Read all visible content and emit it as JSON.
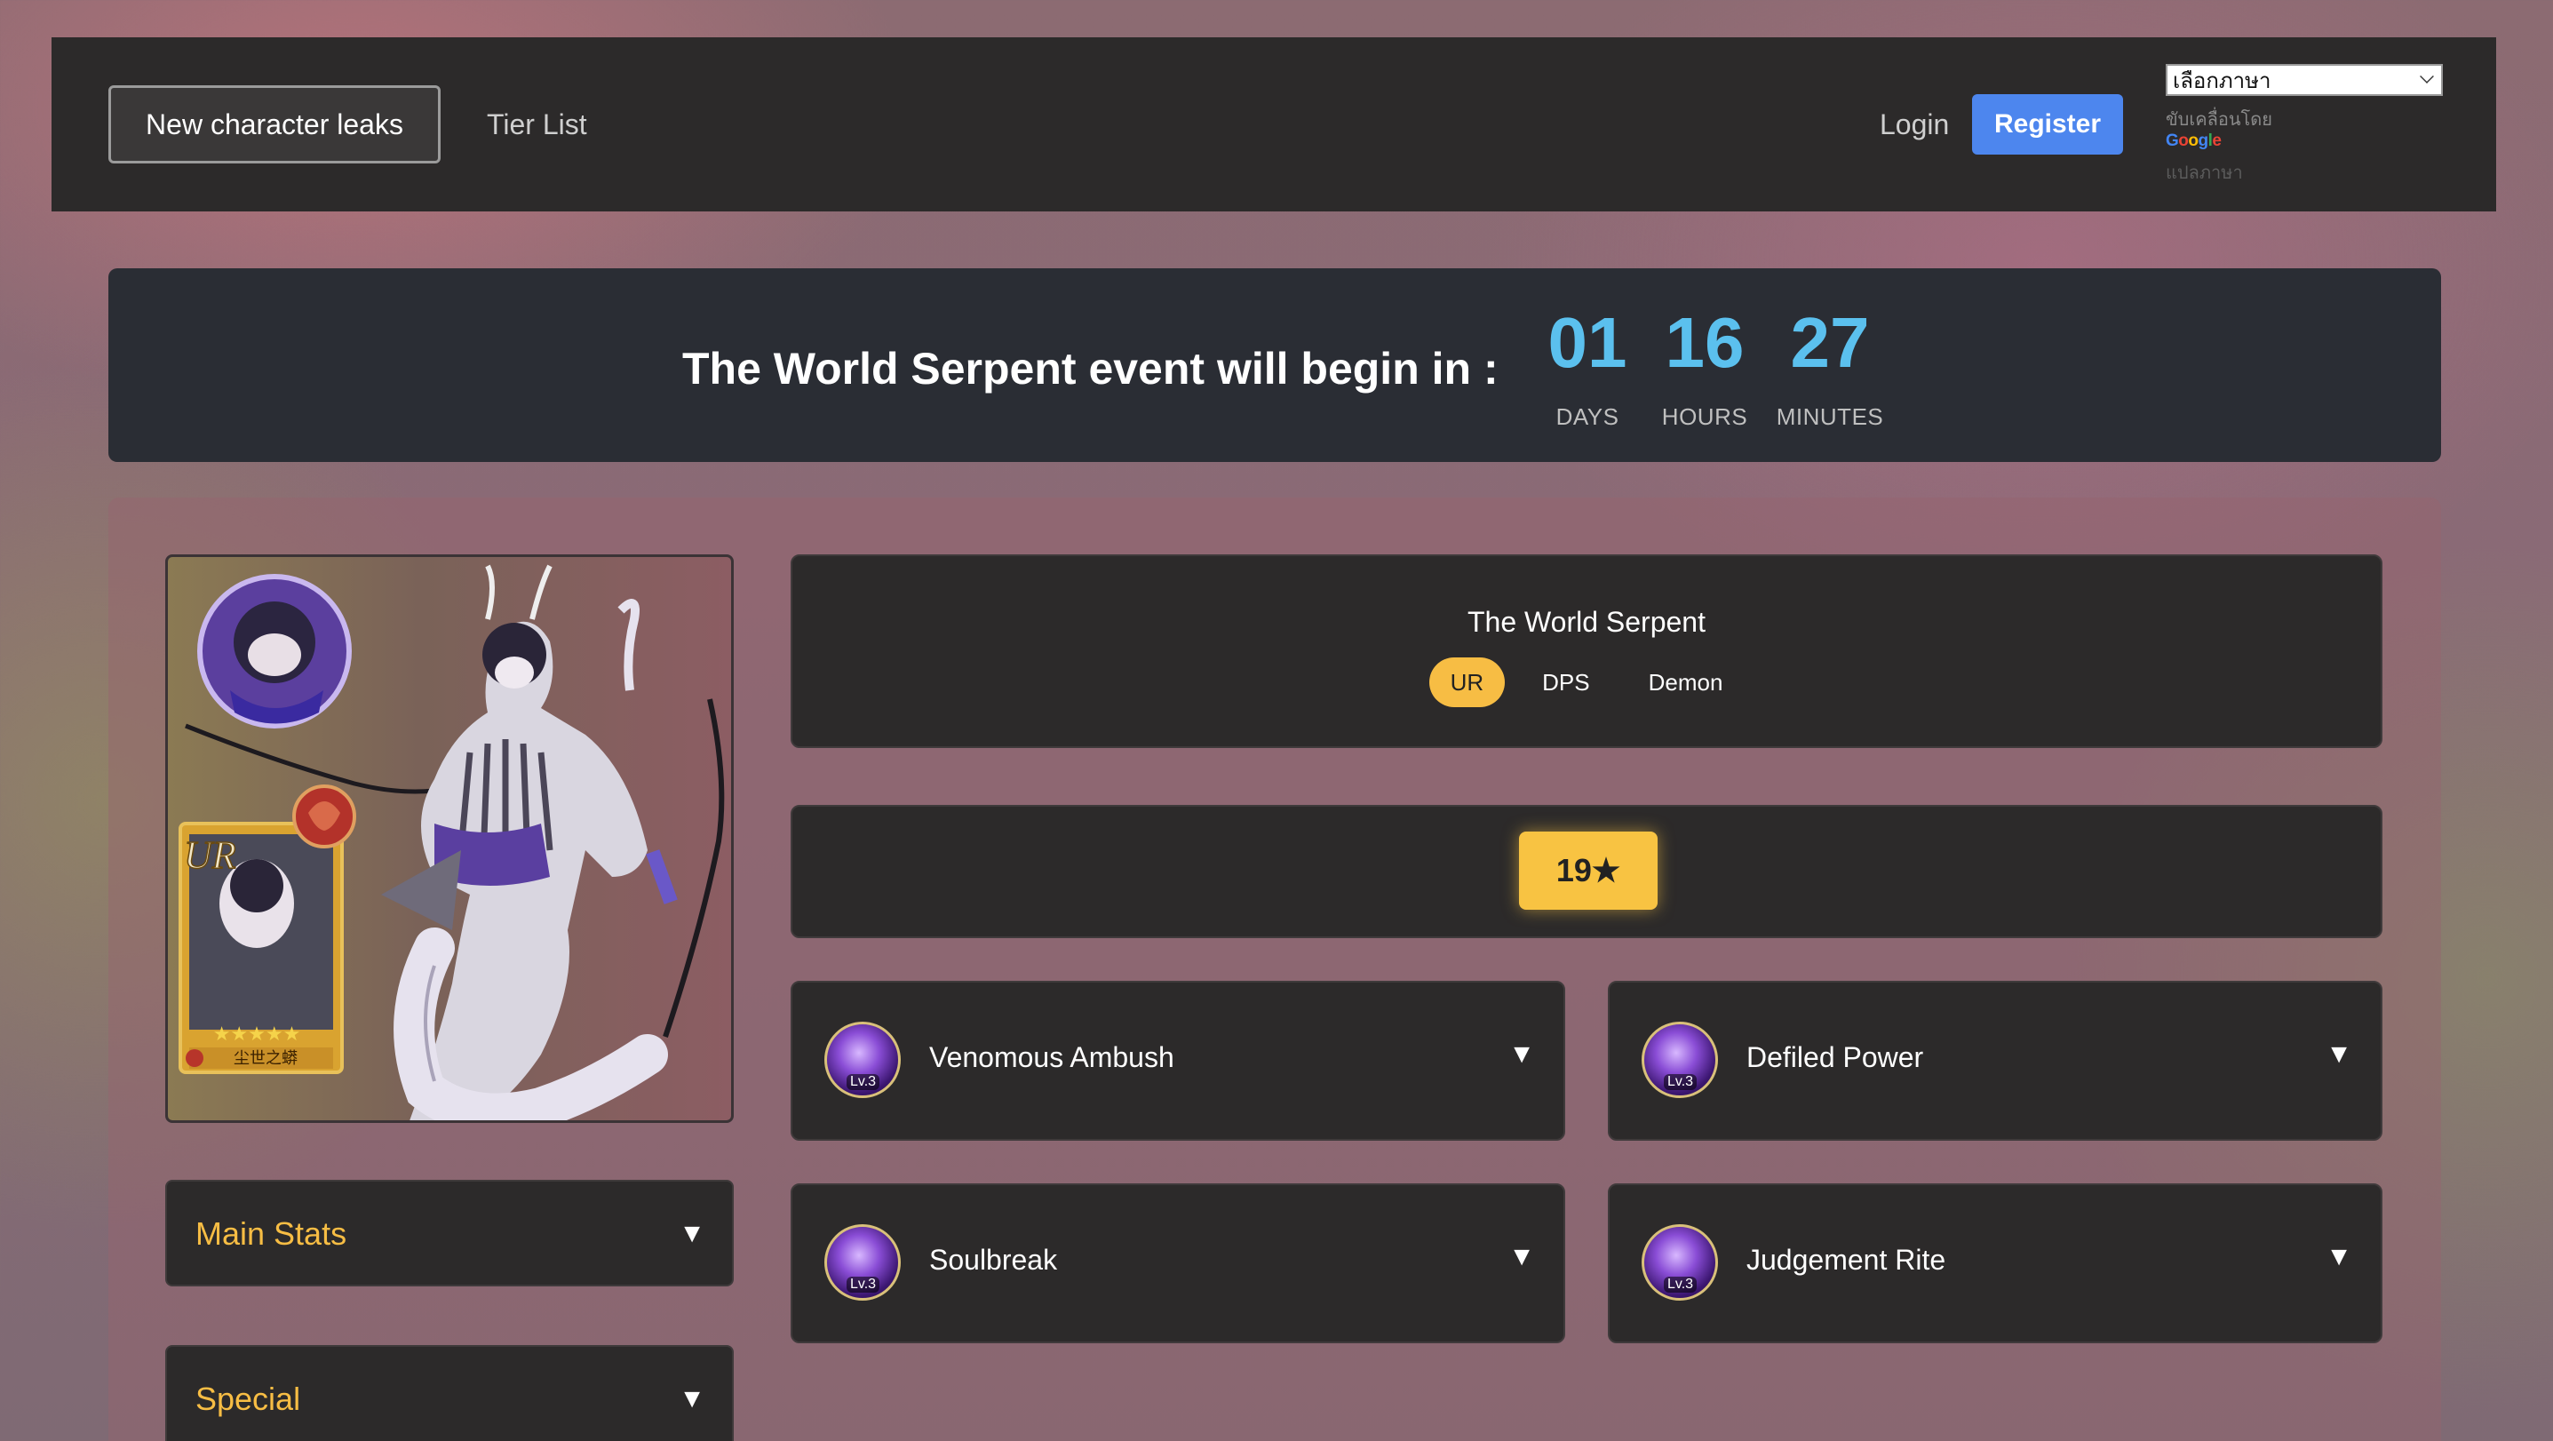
{
  "nav": {
    "new_leaks": "New character leaks",
    "tier_list": "Tier List",
    "login": "Login",
    "register": "Register"
  },
  "translate": {
    "select_label": "เลือกภาษา",
    "powered_by": "ขับเคลื่อนโดย",
    "google": [
      "G",
      "o",
      "o",
      "g",
      "l",
      "e"
    ],
    "translate_link": "แปลภาษา"
  },
  "countdown": {
    "text": "The World Serpent event will begin in :",
    "units": [
      {
        "value": "01",
        "label": "DAYS"
      },
      {
        "value": "16",
        "label": "HOURS"
      },
      {
        "value": "27",
        "label": "MINUTES"
      }
    ]
  },
  "character": {
    "name": "The World Serpent",
    "tags": [
      "UR",
      "DPS",
      "Demon"
    ],
    "stars": "19★"
  },
  "sections": {
    "main_stats": "Main Stats",
    "special": "Special"
  },
  "skills": [
    {
      "name": "Venomous Ambush",
      "level": "Lv.3"
    },
    {
      "name": "Defiled Power",
      "level": "Lv.3"
    },
    {
      "name": "Soulbreak",
      "level": "Lv.3"
    },
    {
      "name": "Judgement Rite",
      "level": "Lv.3"
    }
  ],
  "icons": {
    "collapse_arrow": "▼",
    "card_stars": "★★★★★",
    "card_caption": "尘世之蟒",
    "card_rank": "UR"
  },
  "colors": {
    "accent_gold": "#f7bd44",
    "countdown_blue": "#5bc0ee",
    "register_blue": "#4d86ee"
  }
}
